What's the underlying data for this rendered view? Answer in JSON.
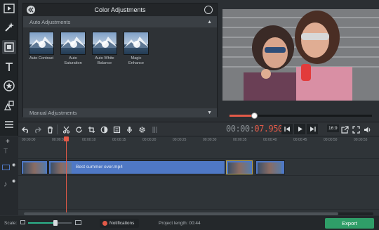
{
  "panel": {
    "title": "Color Adjustments",
    "section_auto": "Auto Adjustments",
    "section_manual": "Manual Adjustments",
    "presets": [
      {
        "label": "Auto Contrast",
        "icon": "contrast-icon"
      },
      {
        "label": "Auto Saturation",
        "icon": "saturation-icon"
      },
      {
        "label": "Auto White Balance",
        "icon": "white-balance-icon"
      },
      {
        "label": "Magic Enhance",
        "icon": "magic-enhance-icon"
      }
    ]
  },
  "player": {
    "progress": 0.17
  },
  "toolbar": {
    "timecode_dim": "00:00:",
    "timecode_hot": "07.950",
    "ratio_label": "16:9"
  },
  "ruler": [
    "00:00:00",
    "00:00:05",
    "00:00:10",
    "00:00:15",
    "00:00:20",
    "00:00:25",
    "00:00:30",
    "00:00:35",
    "00:00:40",
    "00:00:45",
    "00:00:50",
    "00:00:55"
  ],
  "timeline": {
    "clip_name": "Best summer ever.mp4"
  },
  "status": {
    "scale_label": "Scale:",
    "notifications_label": "Notifications",
    "project_length_label": "Project length:",
    "project_length_value": "00:44",
    "export_label": "Export"
  },
  "colors": {
    "accent": "#e35a48",
    "export": "#2f9e68",
    "clip": "#4f78c5",
    "background": "#2b2f33"
  }
}
